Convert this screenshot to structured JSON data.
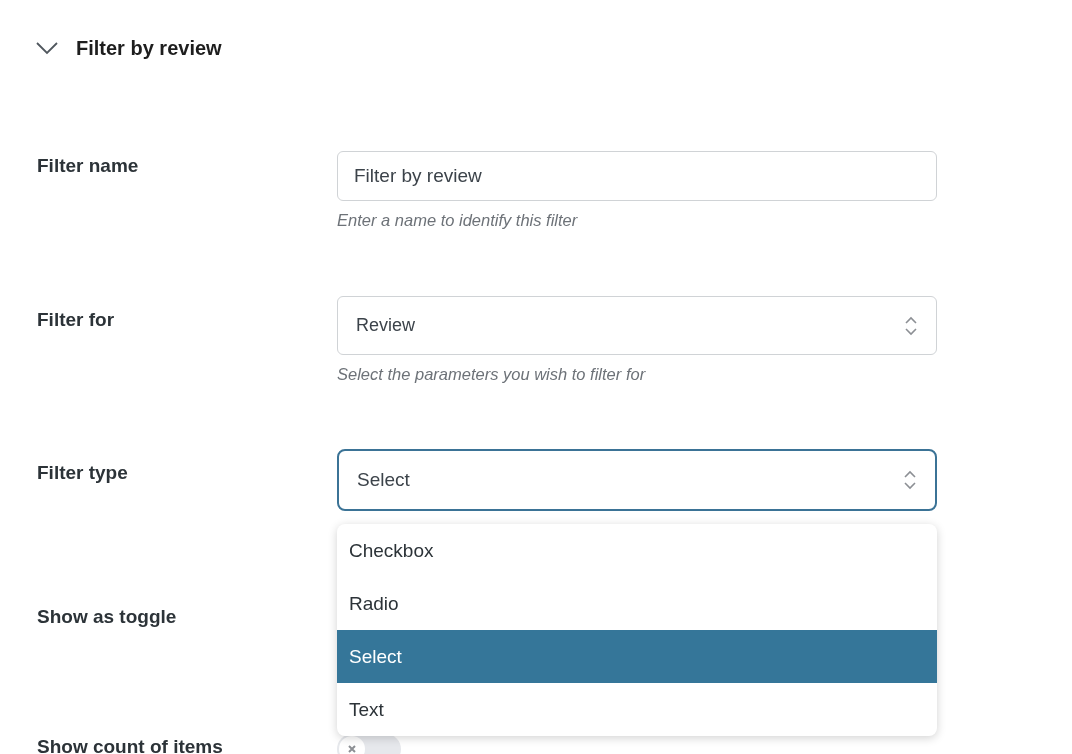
{
  "section": {
    "title": "Filter by review",
    "expanded": true
  },
  "fields": [
    {
      "kind": "text",
      "label": "Filter name",
      "value": "Filter by review",
      "help": "Enter a name to identify this filter"
    },
    {
      "kind": "select",
      "label": "Filter for",
      "value": "Review",
      "help": "Select the parameters you wish to filter for"
    },
    {
      "kind": "select",
      "label": "Filter type",
      "value": "Select",
      "focused": true,
      "menu": [
        {
          "label": "Checkbox",
          "selected": false
        },
        {
          "label": "Radio",
          "selected": false
        },
        {
          "label": "Select",
          "selected": true
        },
        {
          "label": "Text",
          "selected": false
        }
      ]
    },
    {
      "kind": "toggle-hidden",
      "label": "Show as toggle"
    },
    {
      "kind": "toggle",
      "label": "Show count of items",
      "on": false
    }
  ]
}
